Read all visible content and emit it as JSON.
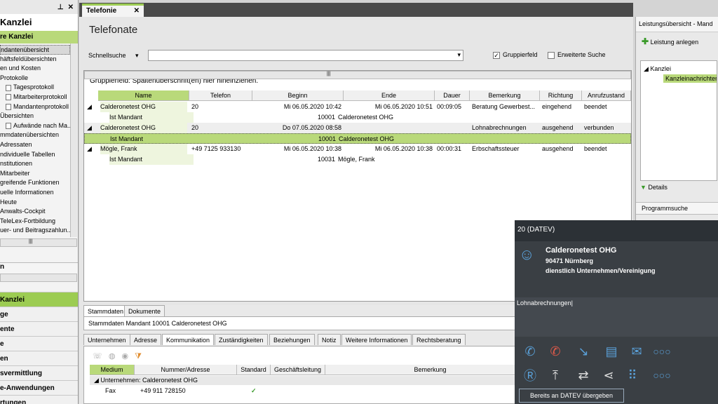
{
  "left_nav": {
    "title": "Kanzlei",
    "section": "re Kanzlei",
    "tree": [
      "ndantenübersicht",
      "häftsfeldübersichten",
      "en und Kosten",
      "Protokolle",
      "Tagesprotokoll",
      "Mitarbeiterprotokoll",
      "Mandantenprotokoll",
      "Übersichten",
      "Aufwände nach Ma...",
      "mmdatenübersichten",
      "Adressaten",
      "ndividuelle Tabellen",
      "nstitutionen",
      "Mitarbeiter",
      "greifende Funktionen",
      "uelle Informationen",
      "Heute",
      "Anwalts-Cockpit",
      "TeleLex-Fortbildung",
      "uer- und Beitragszahlun..."
    ],
    "nav_buttons": [
      "Kanzlei",
      "ge",
      "ente",
      "e",
      "en",
      "svermittlung",
      "e-Anwendungen",
      "rtungen"
    ]
  },
  "tab": {
    "label": "Telefonie",
    "close": "✕"
  },
  "main": {
    "title": "Telefonate",
    "quick_search_label": "Schnellsuche",
    "group_field_label": "Gruppierfeld",
    "extended_search_label": "Erweiterte Suche",
    "group_hint": "Gruppierfeld: Spaltenüberschrift(en) hier hineinziehen.",
    "columns": [
      "Name",
      "Telefon",
      "Beginn",
      "Ende",
      "Dauer",
      "Bemerkung",
      "Richtung",
      "Anrufzustand"
    ],
    "rows": [
      {
        "name": "Calderonetest OHG",
        "telefon": "20",
        "beginn": "Mi 06.05.2020 10:42",
        "ende": "Mi 06.05.2020 10:51",
        "dauer": "00:09:05",
        "bemerkung": "Beratung  Gewerbest...",
        "richtung": "eingehend",
        "zustand": "beendet",
        "sub_label": "Ist Mandant",
        "sub_nr": "10001",
        "sub_name": "Calderonetest OHG"
      },
      {
        "name": "Calderonetest OHG",
        "telefon": "20",
        "beginn": "Do 07.05.2020 08:58",
        "ende": "",
        "dauer": "",
        "bemerkung": "Lohnabrechnungen",
        "richtung": "ausgehend",
        "zustand": "verbunden",
        "sub_label": "Ist Mandant",
        "sub_nr": "10001",
        "sub_name": "Calderonetest OHG"
      },
      {
        "name": "Mögle, Frank",
        "telefon": "+49 7125 933130",
        "beginn": "Mi 06.05.2020 10:38",
        "ende": "Mi 06.05.2020 10:38",
        "dauer": "00:00:31",
        "bemerkung": "Erbschaftssteuer",
        "richtung": "ausgehend",
        "zustand": "beendet",
        "sub_label": "Ist Mandant",
        "sub_nr": "10031",
        "sub_name": "Mögle, Frank"
      }
    ],
    "bottom_tabs": [
      "Stammdaten",
      "Dokumente"
    ],
    "stammdaten_title": "Stammdaten Mandant 10001 Calderonetest OHG",
    "detail_tabs": [
      "Unternehmen",
      "Adresse",
      "Kommunikation",
      "Zuständigkeiten",
      "Beziehungen",
      "Notiz",
      "Weitere Informationen",
      "Rechtsberatung"
    ],
    "comm_columns": [
      "Medium",
      "Nummer/Adresse",
      "Standard",
      "Geschäftsleitung",
      "Bemerkung"
    ],
    "comm_group": "Unternehmen: Calderonetest OHG",
    "comm_row": {
      "medium": "Fax",
      "nummer": "+49 911 728150",
      "standard": "✓"
    }
  },
  "right_panel": {
    "title": "Leistungsübersicht - Mand",
    "add_label": "Leistung anlegen",
    "tree_root": "Kanzlei",
    "tree_child": "Kanzleinachrichten",
    "details_label": "Details",
    "programmsuche_label": "Programmsuche"
  },
  "popup": {
    "header": "20 (DATEV)",
    "caller": "Calderonetest OHG",
    "city": "90471 Nürnberg",
    "type": "dienstlich Unternehmen/Vereinigung",
    "note": "Lohnabrechnungen",
    "handover_button": "Bereits an DATEV übergeben"
  },
  "colors": {
    "accent": "#9ccc52",
    "popup_bg": "#3a3f44",
    "icon_blue": "#5aa0d8",
    "icon_red": "#e05a4a"
  }
}
